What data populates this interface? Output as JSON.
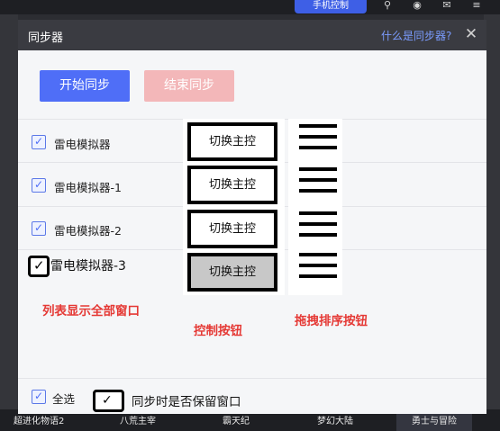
{
  "top_bar": {
    "phone_control_label": "手机控制"
  },
  "dialog": {
    "title": "同步器",
    "help_link": "什么是同步器?",
    "start_button": "开始同步",
    "stop_button": "结束同步",
    "rows": [
      {
        "name": "雷电模拟器",
        "checked": true,
        "control_label": "切换主控"
      },
      {
        "name": "雷电模拟器-1",
        "checked": true,
        "control_label": "切换主控"
      },
      {
        "name": "雷电模拟器-2",
        "checked": true,
        "control_label": "切换主控"
      },
      {
        "name": "雷电模拟器-3",
        "checked": true,
        "control_label": "切换主控"
      }
    ],
    "annotations": {
      "list_note": "列表显示全部窗口",
      "control_note": "控制按钮",
      "drag_note": "拖拽排序按钮"
    },
    "footer": {
      "select_all": "全选",
      "keep_window": "同步时是否保留窗口"
    }
  },
  "bottom_tabs": [
    "超进化物语2",
    "八荒主宰",
    "霸天纪",
    "梦幻大陆",
    "勇士与冒险"
  ],
  "colors": {
    "accent": "#4f6ef7",
    "stop": "#f3b7b9",
    "annotation": "#e53935",
    "header": "#3a3b41"
  }
}
